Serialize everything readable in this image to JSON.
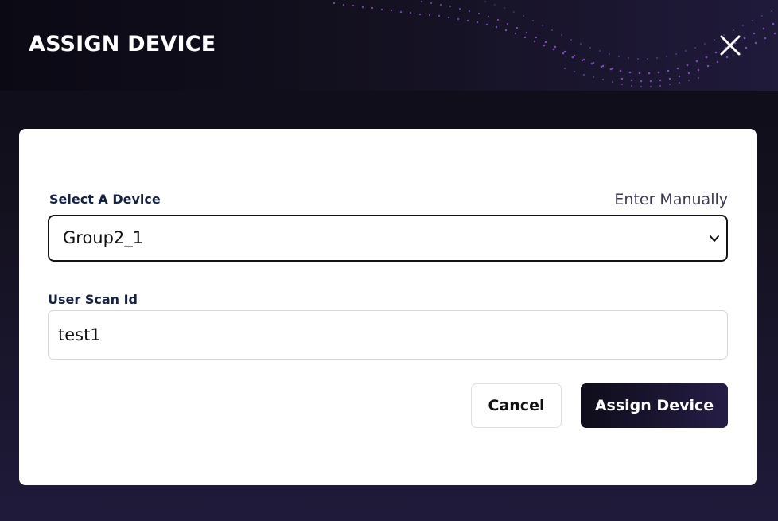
{
  "dialog": {
    "title": "ASSIGN DEVICE",
    "close_icon": "close-icon"
  },
  "form": {
    "device_label": "Select A Device",
    "enter_manually_label": "Enter Manually",
    "device_selected": "Group2_1",
    "device_dropdown_icon": "chevron-down-icon",
    "scan_id_label": "User Scan Id",
    "scan_id_value": "test1"
  },
  "actions": {
    "cancel_label": "Cancel",
    "assign_label": "Assign Device"
  },
  "colors": {
    "header_dark": "#0b0914",
    "header_purple": "#201a3b",
    "accent_dots": "#9a4fd8",
    "label_navy": "#172144",
    "primary_button": "#1c1633"
  }
}
